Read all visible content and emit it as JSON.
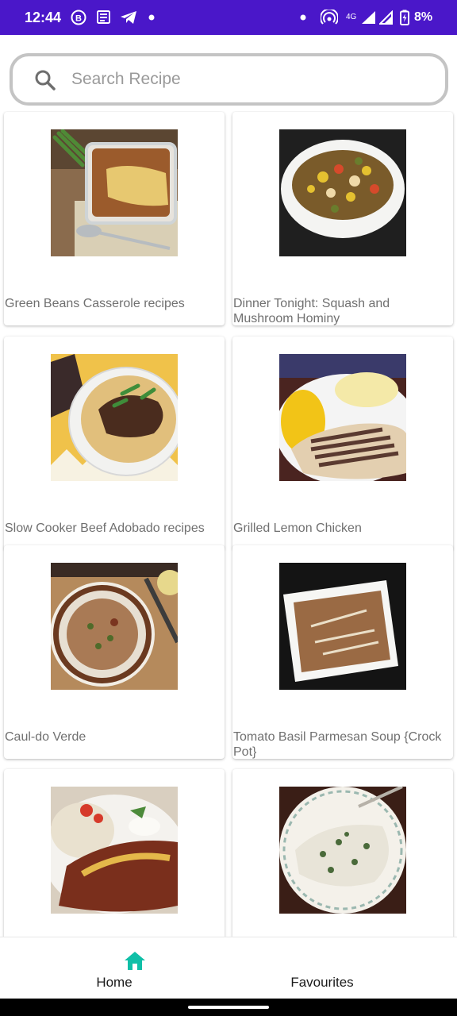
{
  "status_bar": {
    "time": "12:44",
    "battery": "8%",
    "network": "4G",
    "color": "#4a17c9"
  },
  "search": {
    "placeholder": "Search Recipe",
    "value": ""
  },
  "recipes": [
    {
      "title": "Green Beans Casserole recipes",
      "image": "casserole-photo"
    },
    {
      "title": "Dinner Tonight: Squash and Mushroom Hominy",
      "image": "squash-bowl-photo"
    },
    {
      "title": "Slow Cooker Beef Adobado recipes",
      "image": "beef-taco-photo"
    },
    {
      "title": "Grilled Lemon Chicken",
      "image": "grilled-chicken-photo"
    },
    {
      "title": "Caul-do Verde",
      "image": "soup-bowl-photo"
    },
    {
      "title": "Tomato Basil Parmesan Soup {Crock Pot}",
      "image": "tomato-soup-photo"
    },
    {
      "title": "",
      "image": "enchilada-photo"
    },
    {
      "title": "",
      "image": "creamy-chicken-photo"
    }
  ],
  "bottom_nav": {
    "home_label": "Home",
    "favourites_label": "Favourites",
    "active_color": "#0fbfa7"
  }
}
